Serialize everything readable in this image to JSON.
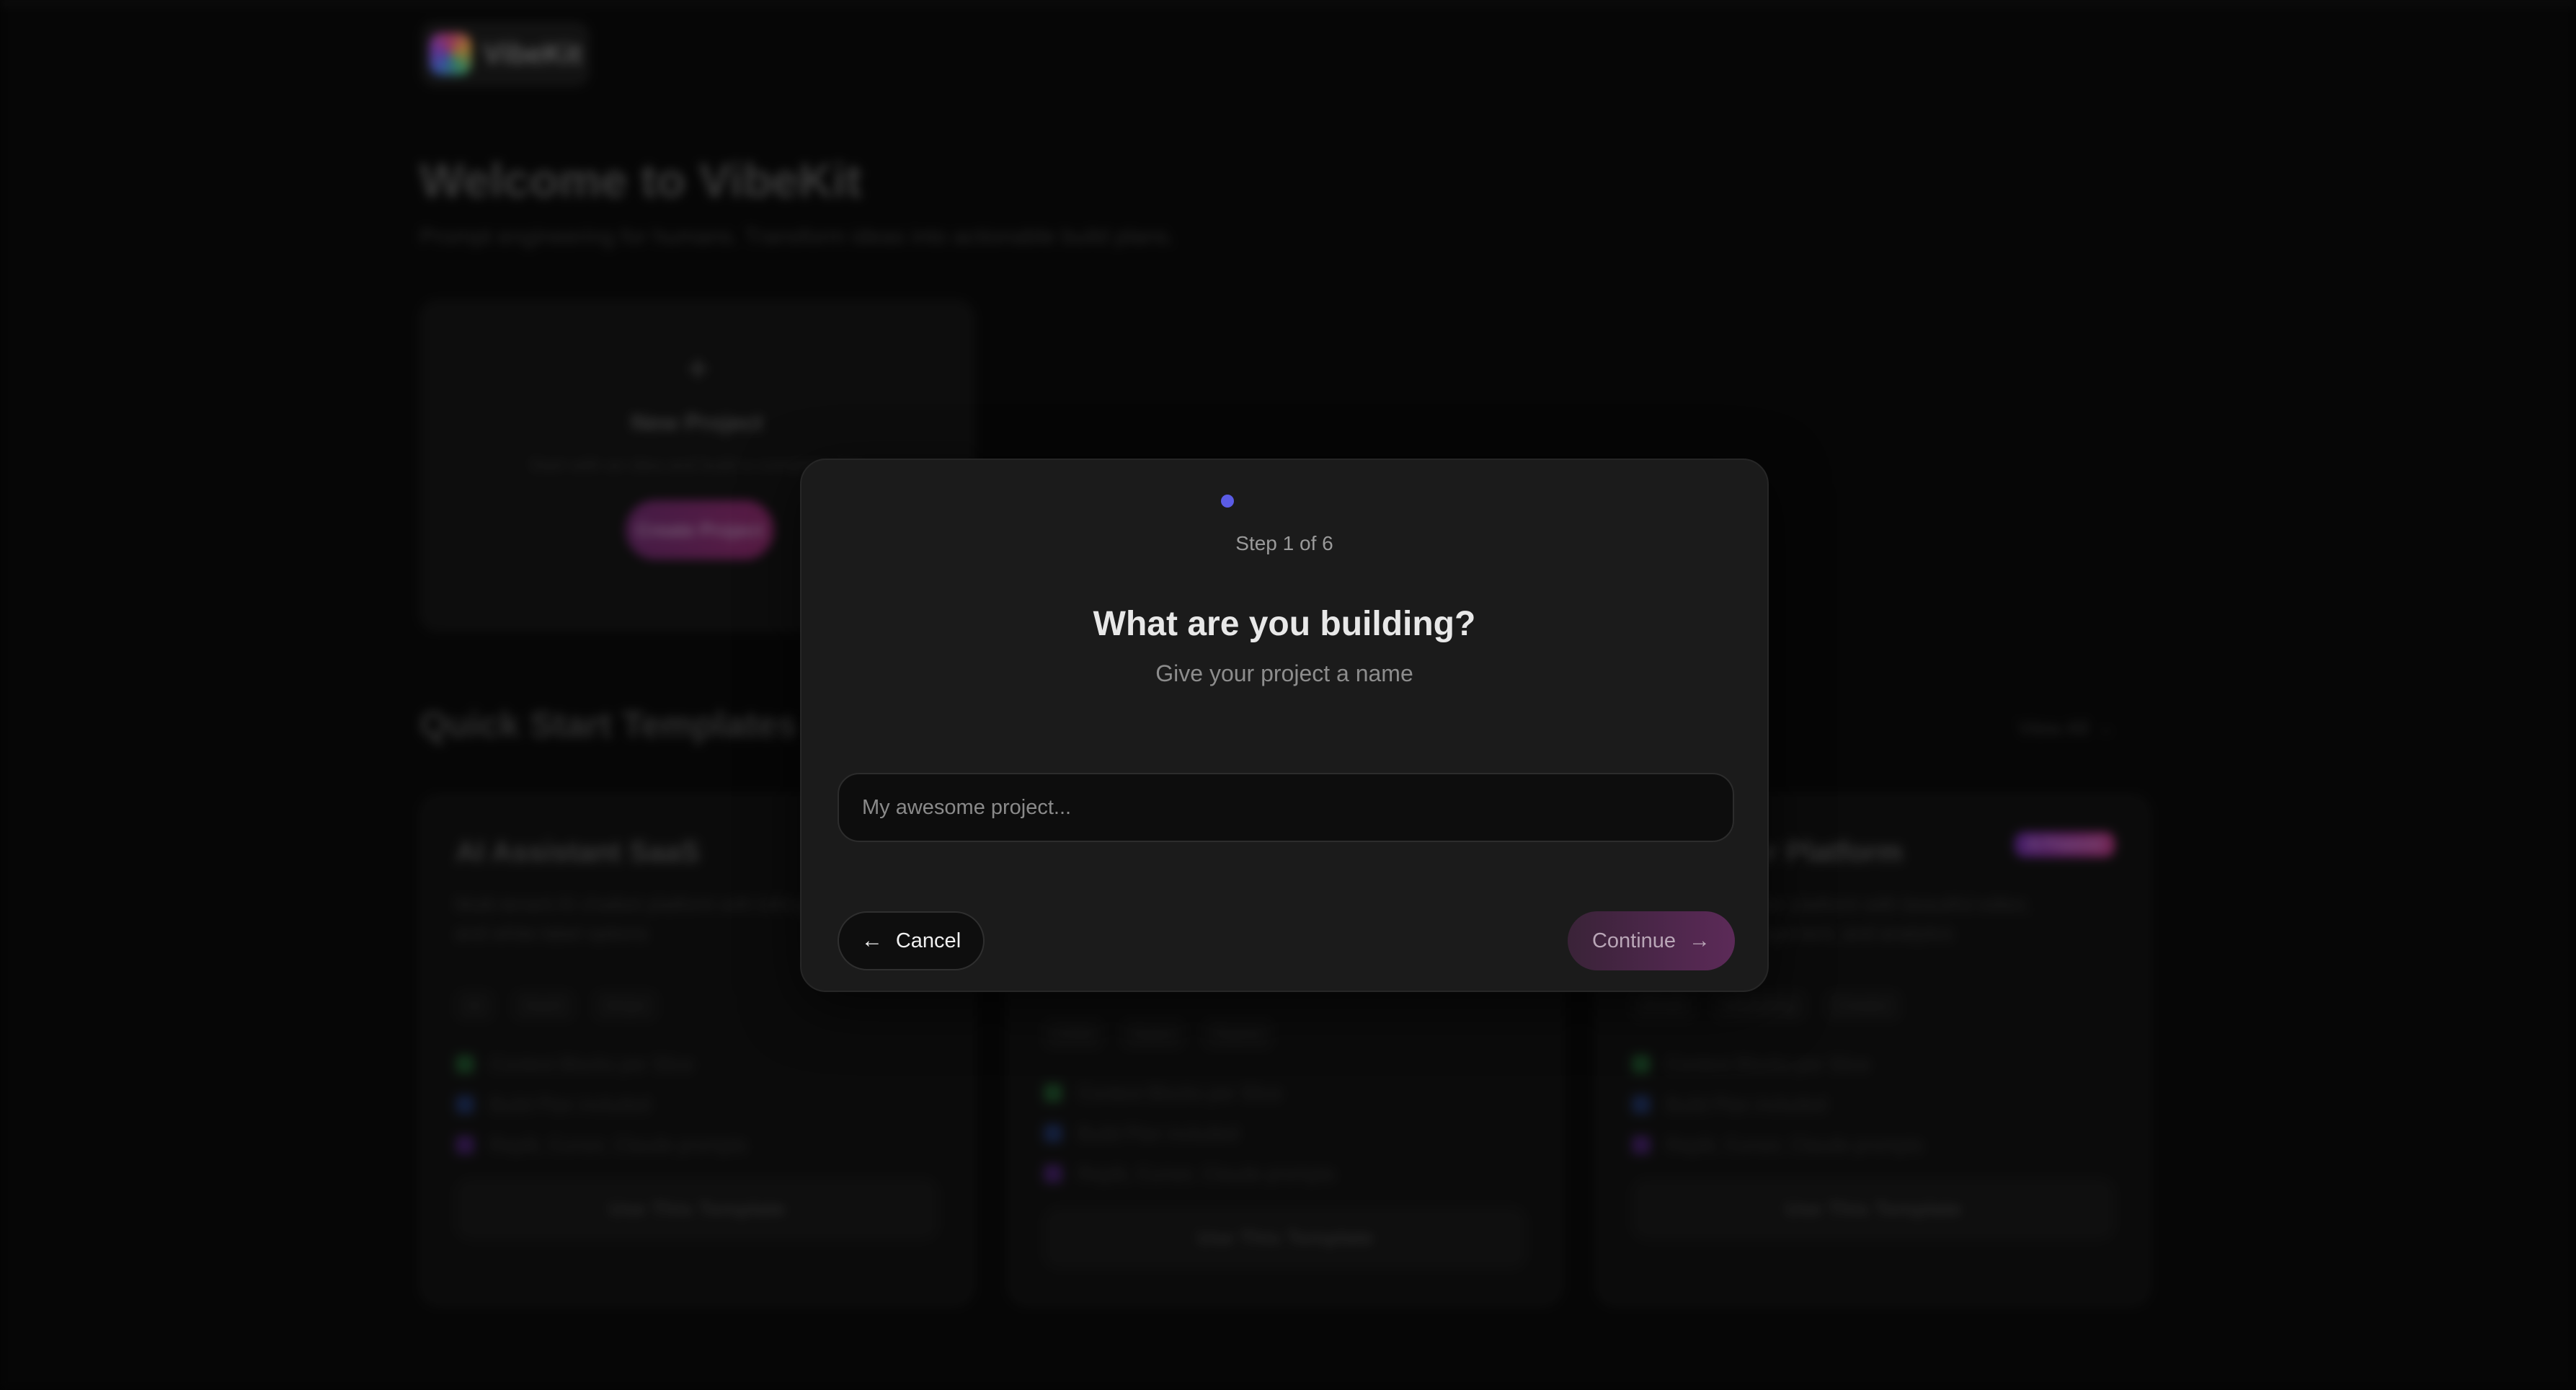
{
  "app": {
    "brand": "VibeKit",
    "welcome_title": "Welcome to VibeKit",
    "welcome_subtitle": "Prompt engineering for humans. Transform ideas into actionable build plans.",
    "new_project": {
      "title": "New Project",
      "description": "Start with an idea and build a complete plan",
      "button_label": "Create Project"
    },
    "templates_section": {
      "title": "Quick Start Templates",
      "view_all_label": "View All"
    },
    "templates": [
      {
        "title": "AI Assistant SaaS",
        "description": "Multi-tenant AI chatbot platform with billing, analytics, and white-label options",
        "tags": [
          "AI",
          "SaaS",
          "Stripe"
        ],
        "features": [
          "Context Blocks per Slice",
          "Build Plan included",
          "Replit, Cursor, Claude prompts"
        ],
        "button_label": "Use This Template"
      },
      {
        "title": "",
        "description": "",
        "tags": [
          "CRM",
          "Sales",
          "Teams"
        ],
        "features": [
          "Context Blocks per Slice",
          "Build Plan included",
          "Replit, Cursor, Claude prompts"
        ],
        "button_label": "Use This Template"
      },
      {
        "title": "Newsletter Platform",
        "badge": "AI Powered",
        "description": "Modern newsletter platform with beautiful editor, subscriber management, and analytics",
        "tags": [
          "Email",
          "Marketing",
          "Creator"
        ],
        "features": [
          "Context Blocks per Slice",
          "Build Plan included",
          "Replit, Cursor, Claude prompts"
        ],
        "button_label": "Use This Template"
      }
    ]
  },
  "modal": {
    "step_label": "Step 1 of 6",
    "title": "What are you building?",
    "subtitle": "Give your project a name",
    "input": {
      "value": "",
      "placeholder": "My awesome project..."
    },
    "cancel_label": "Cancel",
    "continue_label": "Continue",
    "icons": {
      "cancel": "arrow-left-icon",
      "continue": "arrow-right-icon"
    },
    "colors": {
      "step_dot": "#5b5ce6",
      "continue_gradient_start": "#3a2338",
      "continue_gradient_end": "#5c2a58"
    }
  }
}
